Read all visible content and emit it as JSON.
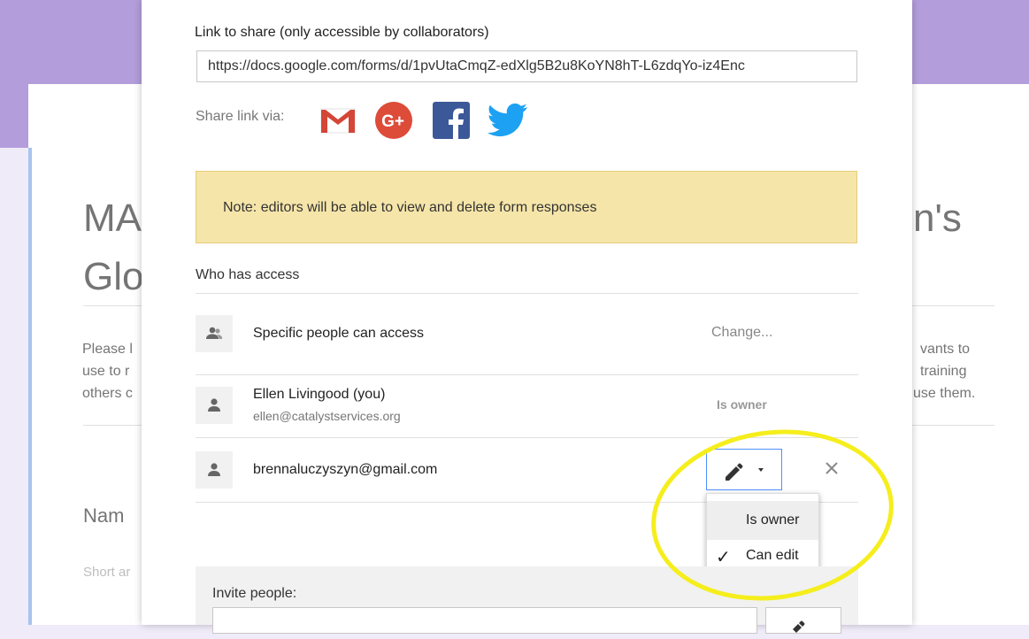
{
  "background_form": {
    "title_line1_left": "MA",
    "title_line1_right": "n's",
    "title_line2_left": "Glo",
    "desc_left": [
      "Please l",
      "use to r",
      "others c"
    ],
    "desc_right": [
      "vants to",
      "training",
      "use them."
    ],
    "question_label": "Nam",
    "answer_placeholder": "Short ar"
  },
  "dialog": {
    "link_label": "Link to share (only accessible by collaborators)",
    "link_value": "https://docs.google.com/forms/d/1pvUtaCmqZ-edXlg5B2u8KoYN8hT-L6zdqYo-iz4Enc",
    "share_via_label": "Share link via:",
    "share_icons": [
      "gmail-icon",
      "google-plus-icon",
      "facebook-icon",
      "twitter-icon"
    ],
    "note": "Note: editors will be able to view and delete form responses",
    "who_has_access": "Who has access",
    "access_setting": {
      "label": "Specific people can access",
      "action": "Change..."
    },
    "people": [
      {
        "name": "Ellen Livingood (you)",
        "email": "ellen@catalystservices.org",
        "role": "Is owner"
      },
      {
        "name": "brennaluczyszyn@gmail.com",
        "email": "",
        "role": "Can edit"
      }
    ],
    "permission_menu": {
      "items": [
        {
          "label": "Is owner",
          "checked": false,
          "hovered": true
        },
        {
          "label": "Can edit",
          "checked": true,
          "hovered": false
        }
      ],
      "check_glyph": "✓"
    },
    "invite": {
      "label": "Invite people:",
      "placeholder": ""
    }
  },
  "colors": {
    "header_purple": "#b39ddb",
    "note_bg": "#f6e5a9",
    "focus_blue": "#4d90fe",
    "annotation_yellow": "#f5ee1c",
    "gmail_red": "#d44638",
    "gplus_red": "#dd4b39",
    "facebook_blue": "#3b5998",
    "twitter_blue": "#1da1f2"
  }
}
